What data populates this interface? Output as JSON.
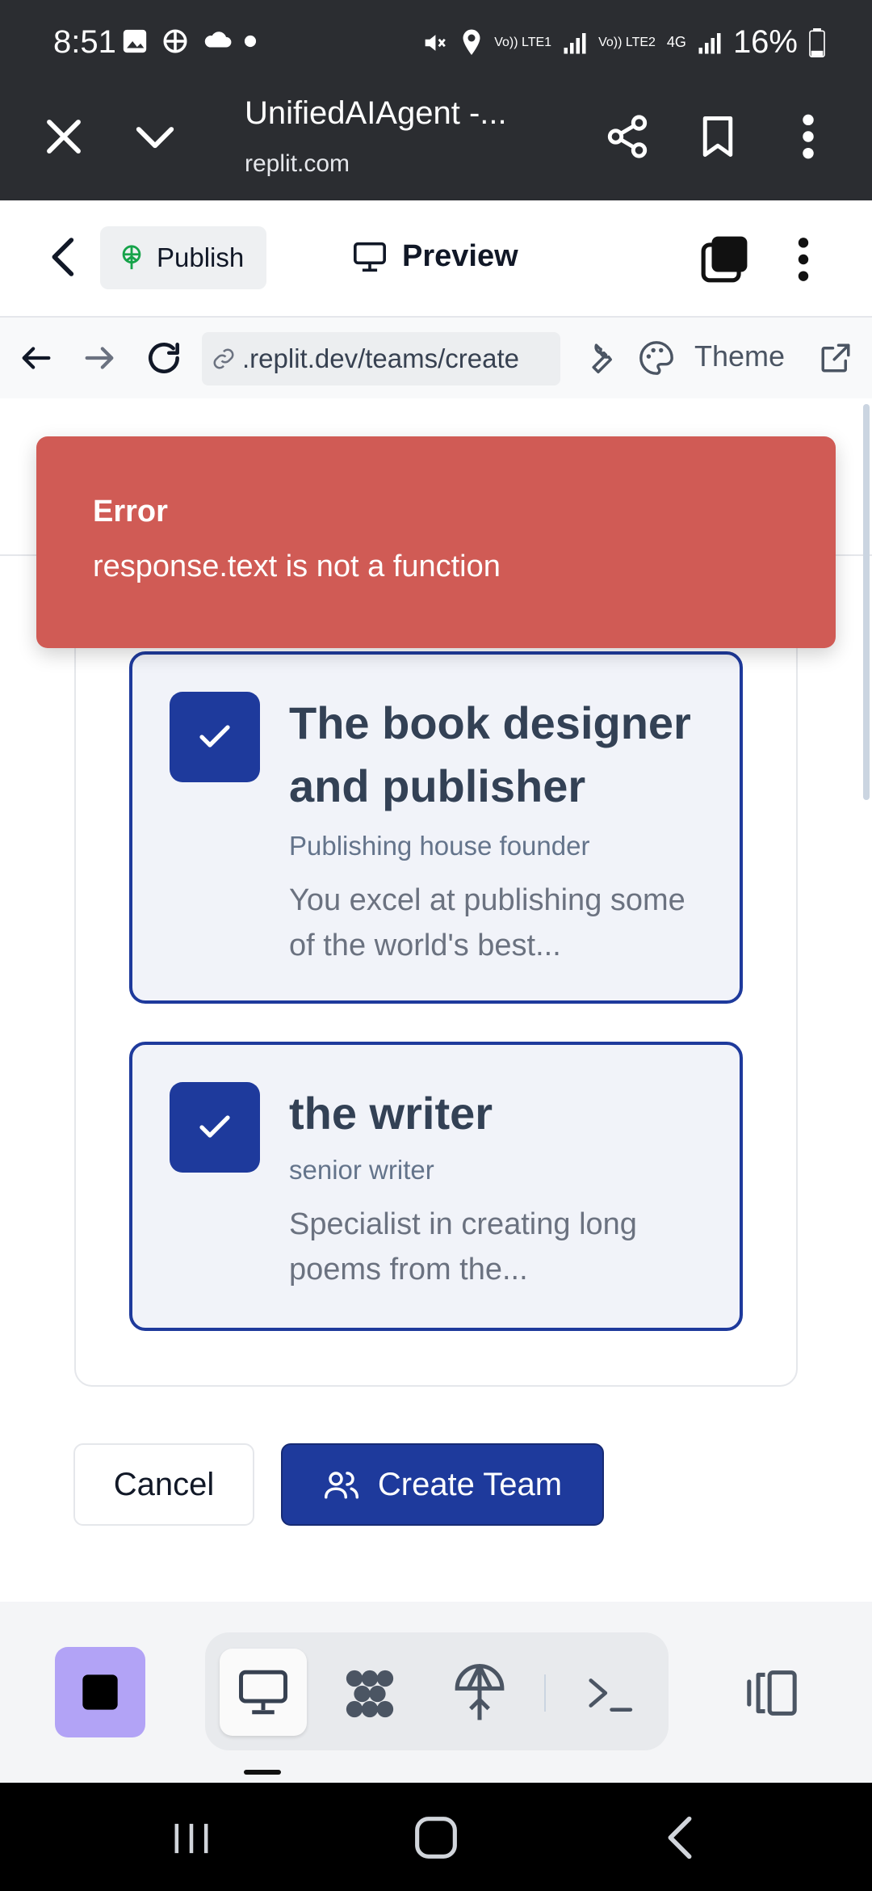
{
  "status_bar": {
    "time": "8:51",
    "battery": "16%",
    "network_1": "Vo)) LTE1",
    "network_2": "Vo)) LTE2",
    "network_type": "4G"
  },
  "browser": {
    "title": "UnifiedAIAgent -...",
    "domain": "replit.com"
  },
  "replit_header": {
    "publish_label": "Publish",
    "preview_label": "Preview"
  },
  "url_bar": {
    "url": ".replit.dev/teams/create",
    "theme_label": "Theme"
  },
  "toast": {
    "title": "Error",
    "message": "response.text is not a function"
  },
  "members": [
    {
      "name": "The book designer and publisher",
      "role": "Publishing house founder",
      "description": "You excel at publishing some of the world's best...",
      "selected": true
    },
    {
      "name": "the writer",
      "role": "senior writer",
      "description": "Specialist in creating long poems from the...",
      "selected": true
    }
  ],
  "actions": {
    "cancel_label": "Cancel",
    "create_label": "Create Team"
  },
  "colors": {
    "primary": "#1e3a9c",
    "error": "#d05b55",
    "stop_button": "#b2a3f6"
  }
}
